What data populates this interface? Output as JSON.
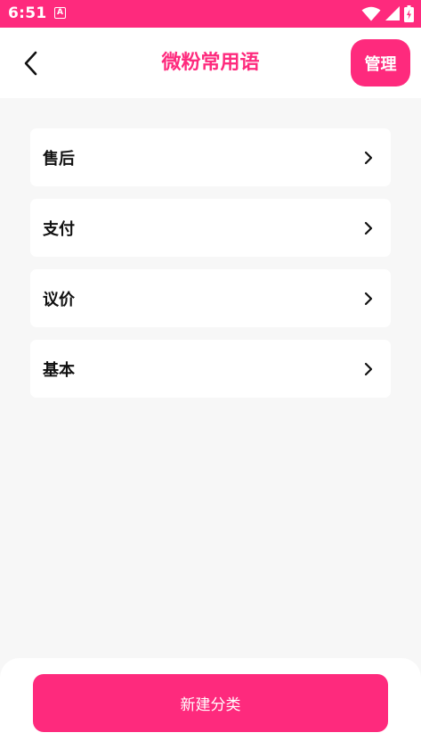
{
  "status_bar": {
    "time": "6:51",
    "notification_glyph": "A",
    "icons": [
      "wifi-icon",
      "signal-icon",
      "battery-charging-icon"
    ]
  },
  "header": {
    "title": "微粉常用语",
    "manage_label": "管理",
    "back_icon": "chevron-left-icon"
  },
  "categories": [
    {
      "label": "售后"
    },
    {
      "label": "支付"
    },
    {
      "label": "议价"
    },
    {
      "label": "基本"
    }
  ],
  "footer": {
    "new_category_label": "新建分类"
  },
  "colors": {
    "accent": "#fe2a7d",
    "background": "#f7f7f7",
    "card": "#ffffff",
    "text": "#111111"
  }
}
